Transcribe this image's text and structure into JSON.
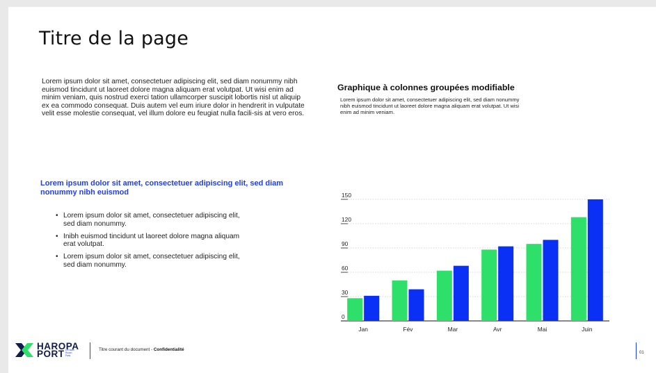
{
  "page": {
    "title": "Titre de la page",
    "intro": "Lorem ipsum dolor sit amet, consectetuer adipiscing elit, sed diam nonummy nibh euismod tincidunt ut laoreet dolore magna aliquam erat volutpat. Ut wisi enim ad minim veniam, quis nostrud exerci tation ullamcorper suscipit lobortis nisl ut aliquip ex ea commodo consequat. Duis autem vel eum iriure dolor in hendrerit in vulputate velit esse molestie consequat, vel illum dolore eu feugiat nulla facili-sis at vero eros.",
    "sub_heading": "Lorem ipsum dolor sit amet, consectetuer adipiscing elit, sed diam nonummy nibh euismod",
    "bullets": [
      "Lorem ipsum dolor sit amet, consectetuer adipiscing elit, sed diam nonummy.",
      "Inibh euismod tincidunt ut laoreet dolore magna aliquam erat volutpat.",
      "Lorem ipsum dolor sit amet, consectetuer adipiscing elit, sed diam nonummy."
    ]
  },
  "chart_section": {
    "title": "Graphique à colonnes groupées modifiable",
    "description": "Lorem ipsum dolor sit amet, consectetuer adipiscing elit, sed diam nonummy nibh euismod tincidunt ut laoreet dolore magna aliquam erat volutpat. Ut wisi enim ad minim veniam."
  },
  "chart_data": {
    "type": "bar",
    "categories": [
      "Jan",
      "Fév",
      "Mar",
      "Avr",
      "Mai",
      "Juin"
    ],
    "series": [
      {
        "values": [
          28,
          50,
          62,
          88,
          95,
          128
        ],
        "color": "#2ee06a"
      },
      {
        "values": [
          31,
          39,
          68,
          92,
          100,
          150
        ],
        "color": "#0a30f5"
      }
    ],
    "yticks": [
      0,
      30,
      60,
      90,
      120,
      150
    ],
    "ylim": [
      0,
      150
    ],
    "grid": true,
    "grid_style": "dotted"
  },
  "footer": {
    "logo_top": "HAROPA",
    "logo_bottom": "PORT",
    "logo_small": "Le Havre Rouen Paris",
    "running_title": "Titre courant du document - ",
    "confidentiality": "Confidentialité",
    "page_number": "01"
  },
  "colors": {
    "accent_blue": "#1f3df2",
    "bar_green": "#2ee06a",
    "bar_blue": "#0a30f5",
    "logo_navy": "#101c4a"
  }
}
